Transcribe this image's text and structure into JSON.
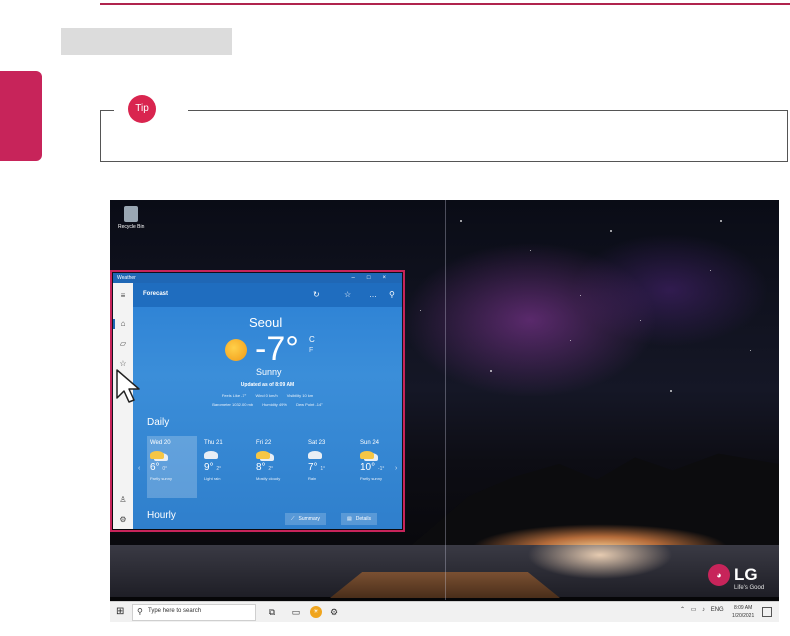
{
  "tip": {
    "label": "Tip"
  },
  "desktop": {
    "recycle_bin_label": "Recycle Bin",
    "brand": {
      "logo": "LG",
      "tagline": "Life's Good"
    }
  },
  "taskbar": {
    "search_placeholder": "Type here to search",
    "language": "ENG",
    "time": "8:09 AM",
    "date": "1/20/2021"
  },
  "weather_app": {
    "window_title": "Weather",
    "section_title": "Forecast",
    "city": "Seoul",
    "temperature": "-7°",
    "unit_c": "C",
    "unit_f": "F",
    "condition": "Sunny",
    "updated": "Updated as of 8:09 AM",
    "details_row1": [
      "Feels Like -7°",
      "Wind 0 km/h",
      "Visibility 10 km"
    ],
    "details_row2": [
      "Barometer 1032.00 mb",
      "Humidity 49%",
      "Dew Point -14°"
    ],
    "daily_title": "Daily",
    "days": [
      {
        "label": "Wed 20",
        "high": "6°",
        "low": "0°",
        "desc": "Partly sunny",
        "icon": "partly-sunny"
      },
      {
        "label": "Thu 21",
        "high": "9°",
        "low": "2°",
        "desc": "Light rain",
        "icon": "light-rain"
      },
      {
        "label": "Fri 22",
        "high": "8°",
        "low": "2°",
        "desc": "Mostly cloudy",
        "icon": "partly-sunny"
      },
      {
        "label": "Sat 23",
        "high": "7°",
        "low": "1°",
        "desc": "Rain",
        "icon": "rain"
      },
      {
        "label": "Sun 24",
        "high": "10°",
        "low": "-1°",
        "desc": "Partly sunny",
        "icon": "partly-sunny"
      }
    ],
    "hourly_title": "Hourly",
    "summary_button": "Summary",
    "details_button": "Details"
  },
  "colors": {
    "accent": "#c7245a",
    "weather_blue": "#2a7fd4"
  }
}
